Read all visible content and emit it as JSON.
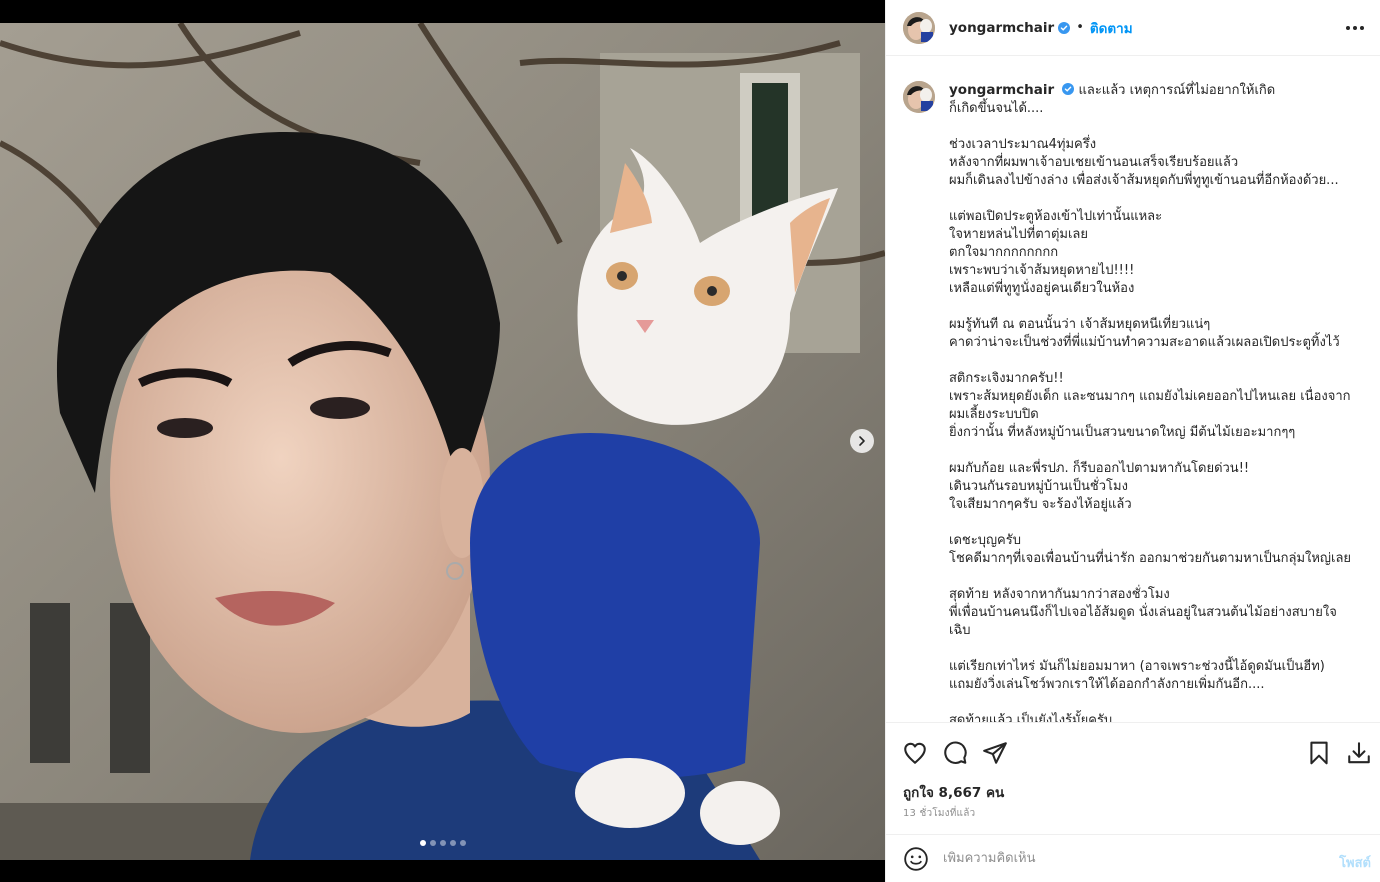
{
  "post": {
    "username": "yongarmchair",
    "separator": "•",
    "follow_label": "ติดตาม",
    "caption_lines": [
      "และแล้ว เหตุการณ์ที่ไม่อยากให้เกิด",
      "ก็เกิดขึ้นจนได้....",
      "",
      "ช่วงเวลาประมาณ4ทุ่มครึ่ง",
      "หลังจากที่ผมพาเจ้าอบเชยเข้านอนเสร็จเรียบร้อยแล้ว",
      "ผมก็เดินลงไปข้างล่าง เพื่อส่งเจ้าส้มหยุดกับพี่ทูทูเข้านอนที่อีกห้องด้วย...",
      "",
      "แต่พอเปิดประตูห้องเข้าไปเท่านั้นแหละ",
      "ใจหายหล่นไปที่ตาตุ่มเลย",
      "ตกใจมากกกกกกกก",
      "เพราะพบว่าเจ้าส้มหยุดหายไป!!!!",
      "เหลือแต่พี่ทูทูนั่งอยู่คนเดียวในห้อง",
      "",
      "ผมรู้ทันที ณ ตอนนั้นว่า เจ้าส้มหยุดหนีเที่ยวแน่ๆ",
      "คาดว่าน่าจะเป็นช่วงที่พี่แม่บ้านทำความสะอาดแล้วเผลอเปิดประตูทิ้งไว้",
      "",
      "สติกระเจิงมากครับ!!",
      "เพราะส้มหยุดยังเด็ก และซนมากๆ แถมยังไม่เคยออกไปไหนเลย เนื่องจาก",
      "ผมเลี้ยงระบบปิด",
      "ยิ่งกว่านั้น ที่หลังหมู่บ้านเป็นสวนขนาดใหญ่ มีต้นไม้เยอะมากๆๆ",
      "",
      "ผมกับก้อย และพี่รปภ. ก็รีบออกไปตามหากันโดยด่วน!!",
      "เดินวนกันรอบหมู่บ้านเป็นชั่วโมง",
      "ใจเสียมากๆครับ จะร้องไห้อยู่แล้ว",
      "",
      "เดชะบุญครับ",
      "โชคดีมากๆที่เจอเพื่อนบ้านที่น่ารัก ออกมาช่วยกันตามหาเป็นกลุ่มใหญ่เลย",
      "",
      "สุดท้าย หลังจากหากันมากว่าสองชั่วโมง",
      "พี่เพื่อนบ้านคนนึงก็ไปเจอไอ้ส้มดูด นั่งเล่นอยู่ในสวนต้นไม้อย่างสบายใจ",
      "เฉิบ",
      "",
      "แต่เรียกเท่าไหร่ มันก็ไม่ยอมมาหา (อาจเพราะช่วงนี้ไอ้ดูดมันเป็นฮีท)",
      "แถมยังวิ่งเล่นโชว์พวกเราให้ได้ออกกำลังกายเพิ่มกันอีก....",
      "",
      "สุดท้ายแล้ว เป็นยังไงรู้มั้ยครับ"
    ],
    "likes_text": "ถูกใจ 8,667 คน",
    "time_text": "13 ชั่วโมงที่แล้ว",
    "comment_placeholder": "เพิ่มความคิดเห็น",
    "post_button_label": "โพสต์"
  },
  "carousel": {
    "total_slides": 5,
    "active_index": 0
  },
  "icons": {
    "more": "more-options-icon",
    "verified": "verified-badge-icon",
    "like": "heart-icon",
    "comment": "comment-bubble-icon",
    "share": "paper-plane-icon",
    "save": "bookmark-icon",
    "download": "download-icon",
    "emoji": "emoji-smiley-icon",
    "next": "chevron-right-icon"
  },
  "colors": {
    "accent_link": "#0095f6",
    "post_button_disabled": "#b2dffc",
    "verified": "#3897f0",
    "muted_text": "#8e8e8e",
    "divider": "#efefef"
  }
}
